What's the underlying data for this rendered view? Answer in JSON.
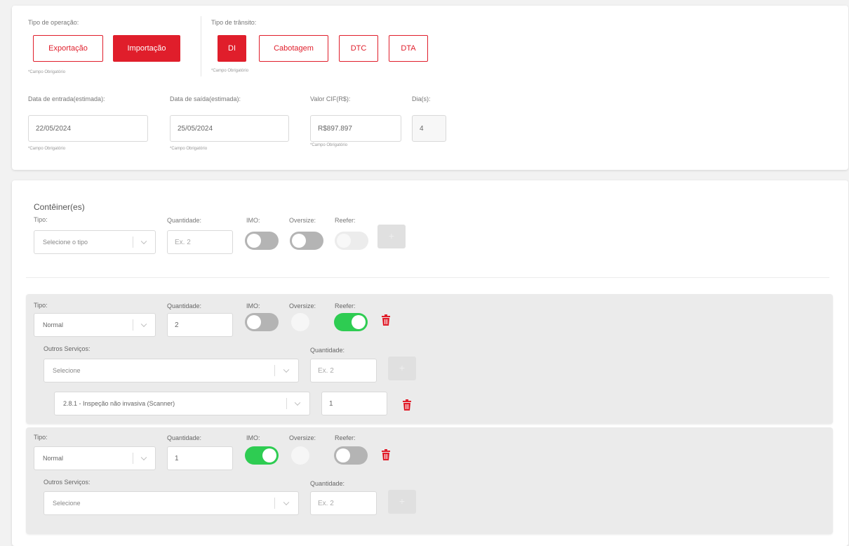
{
  "operacao": {
    "label": "Tipo de operação:",
    "exportacao": "Exportação",
    "importacao": "Importação",
    "required": "*Campo Obrigatório"
  },
  "transito": {
    "label": "Tipo de trânsito:",
    "di": "DI",
    "cabotagem": "Cabotagem",
    "dtc": "DTC",
    "dta": "DTA",
    "required": "*Campo Obrigatório"
  },
  "datas": {
    "entrada_label": "Data de entrada(estimada):",
    "entrada_value": "22/05/2024",
    "saida_label": "Data de saída(estimada):",
    "saida_value": "25/05/2024",
    "valor_label": "Valor CIF(R$):",
    "valor_value": "R$897.897",
    "dias_label": "Dia(s):",
    "dias_value": "4",
    "required": "*Campo Obrigatório"
  },
  "containers": {
    "title": "Contêiner(es)",
    "tipo_label": "Tipo:",
    "quantidade_label": "Quantidade:",
    "imo_label": "IMO:",
    "oversize_label": "Oversize:",
    "reefer_label": "Reefer:",
    "tipo_placeholder": "Selecione o tipo",
    "quantidade_placeholder": "Ex. 2",
    "outros_label": "Outros Serviços:",
    "outros_placeholder": "Selecione",
    "items": [
      {
        "tipo": "Normal",
        "quantidade": "2",
        "imo": false,
        "reefer": true,
        "servico": "2.8.1 - Inspeção não invasiva (Scanner)",
        "servico_quantidade": "1"
      },
      {
        "tipo": "Normal",
        "quantidade": "1",
        "imo": true,
        "reefer": false
      }
    ]
  },
  "colors": {
    "accent": "#e01e2b",
    "toggle_on": "#2ecc52",
    "toggle_off": "#b4b4b4"
  }
}
